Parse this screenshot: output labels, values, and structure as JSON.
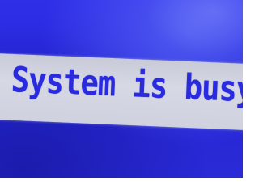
{
  "screen": {
    "message": "System is busy.",
    "colors": {
      "background": "#2a2ad8",
      "banner": "#d0d2e0",
      "text": "#2a2adf"
    }
  }
}
